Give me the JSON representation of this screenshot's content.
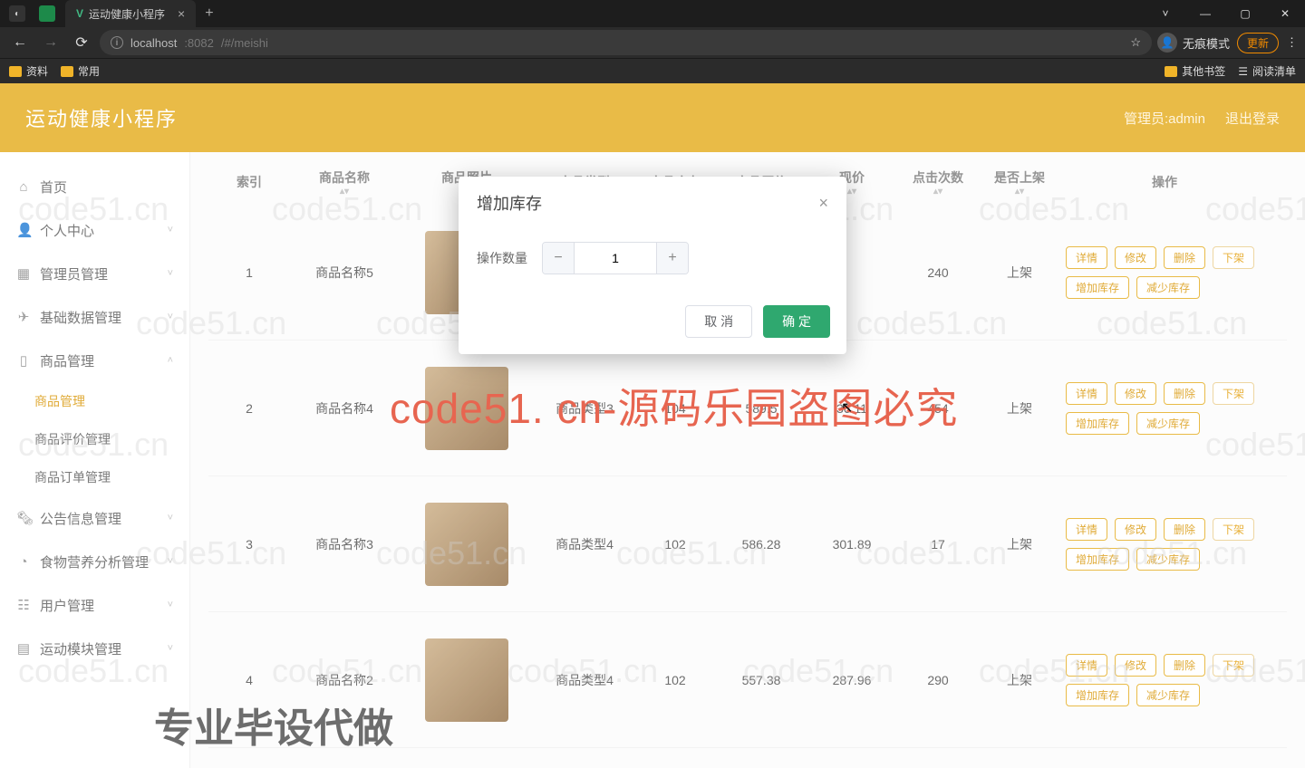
{
  "browser": {
    "tab_title": "运动健康小程序",
    "url_host": "localhost",
    "url_port": ":8082",
    "url_path": "/#/meishi",
    "incognito_label": "无痕模式",
    "update_label": "更新",
    "bookmarks": {
      "a": "资料",
      "b": "常用",
      "other": "其他书签",
      "read": "阅读清单"
    }
  },
  "app": {
    "title": "运动健康小程序",
    "user_label": "管理员:admin",
    "logout_label": "退出登录"
  },
  "sidebar": {
    "home": "首页",
    "personal": "个人中心",
    "admin": "管理员管理",
    "basic": "基础数据管理",
    "goods": "商品管理",
    "goods_sub1": "商品管理",
    "goods_sub2": "商品评价管理",
    "goods_sub3": "商品订单管理",
    "notice": "公告信息管理",
    "food": "食物营养分析管理",
    "users": "用户管理",
    "sport": "运动模块管理"
  },
  "table": {
    "hdr": {
      "idx": "索引",
      "name": "商品名称",
      "photo": "商品照片",
      "type": "商品类型",
      "stock": "商品库存",
      "orig": "商品原价",
      "price": "现价",
      "clicks": "点击次数",
      "onshelf": "是否上架",
      "ops": "操作"
    },
    "ops": {
      "detail": "详情",
      "edit": "修改",
      "del": "删除",
      "off": "下架",
      "addstock": "增加库存",
      "substock": "减少库存"
    },
    "rows": [
      {
        "idx": "1",
        "name": "商品名称5",
        "type": "",
        "stock": "",
        "orig": "",
        "price": "",
        "clicks": "240",
        "onshelf": "上架"
      },
      {
        "idx": "2",
        "name": "商品名称4",
        "type": "商品类型3",
        "stock": "104",
        "orig": "589.5",
        "price": "36.11",
        "clicks": "454",
        "onshelf": "上架"
      },
      {
        "idx": "3",
        "name": "商品名称3",
        "type": "商品类型4",
        "stock": "102",
        "orig": "586.28",
        "price": "301.89",
        "clicks": "17",
        "onshelf": "上架"
      },
      {
        "idx": "4",
        "name": "商品名称2",
        "type": "商品类型4",
        "stock": "102",
        "orig": "557.38",
        "price": "287.96",
        "clicks": "290",
        "onshelf": "上架"
      }
    ]
  },
  "modal": {
    "title": "增加库存",
    "qty_label": "操作数量",
    "qty_value": "1",
    "cancel": "取 消",
    "ok": "确 定"
  },
  "watermarks": {
    "wm": "code51.cn",
    "big": "code51. cn-源码乐园盗图必究",
    "bottom": "专业毕设代做"
  }
}
